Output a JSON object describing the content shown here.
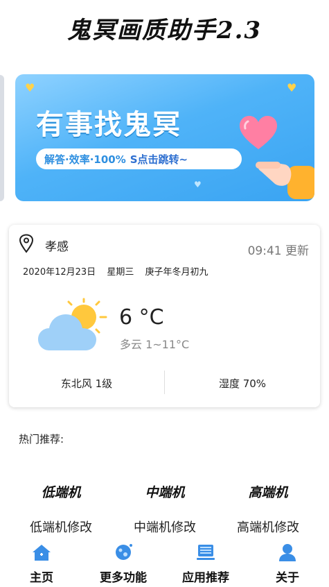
{
  "app": {
    "title": "鬼冥画质助手2.3"
  },
  "banner": {
    "headline": "有事找鬼冥",
    "pill_text": "解答·效率·100%",
    "pill_action": "S点击跳转~"
  },
  "weather": {
    "city": "孝感",
    "update_time": "09:41 更新",
    "date": "2020年12月23日",
    "weekday": "星期三",
    "lunar": "庚子年冬月初九",
    "temperature": "6 °C",
    "condition": "多云 1~11°C",
    "wind": "东北风 1级",
    "humidity": "湿度 70%"
  },
  "recommend": {
    "title": "热门推荐:",
    "items": [
      {
        "tag": "低端机",
        "label": "低端机修改"
      },
      {
        "tag": "中端机",
        "label": "中端机修改"
      },
      {
        "tag": "高端机",
        "label": "高端机修改"
      }
    ]
  },
  "nav": {
    "items": [
      {
        "label": "主页",
        "icon": "home-icon"
      },
      {
        "label": "更多功能",
        "icon": "planet-icon"
      },
      {
        "label": "应用推荐",
        "icon": "device-icon"
      },
      {
        "label": "关于",
        "icon": "user-icon"
      }
    ]
  },
  "colors": {
    "banner": "#4fb3f8",
    "accent": "#2e8fe0",
    "nav_icon": "#3a8ee6"
  }
}
